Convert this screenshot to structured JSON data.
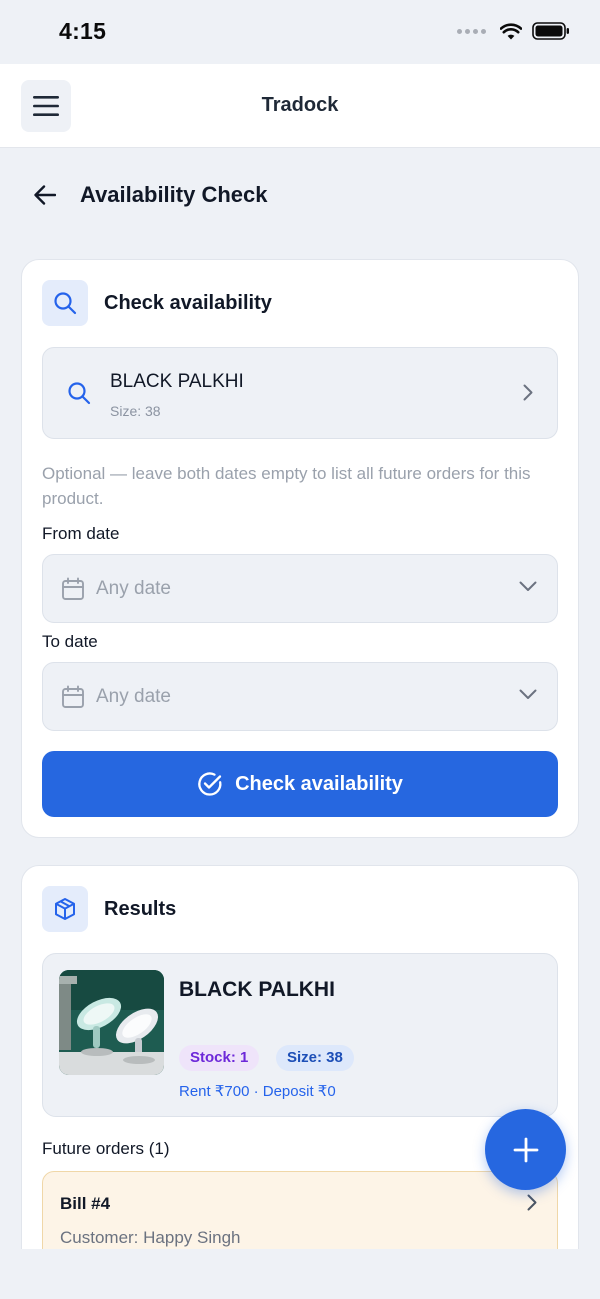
{
  "status_bar": {
    "time": "4:15"
  },
  "header": {
    "title": "Tradock"
  },
  "page": {
    "title": "Availability Check"
  },
  "search_card": {
    "title": "Check availability",
    "product": {
      "name": "BLACK PALKHI",
      "size": "Size: 38"
    },
    "hint": "Optional — leave both dates empty to list all future orders for this product.",
    "from_label": "From date",
    "from_value": "Any date",
    "to_label": "To date",
    "to_value": "Any date",
    "submit_label": "Check availability"
  },
  "results_card": {
    "title": "Results",
    "item": {
      "name": "BLACK PALKHI",
      "stock": "Stock: 1",
      "size": "Size: 38",
      "price": "Rent ₹700 · Deposit ₹0"
    },
    "future_label": "Future orders (1)",
    "orders": [
      {
        "bill": "Bill #4",
        "customer": "Customer: Happy Singh"
      }
    ]
  },
  "colors": {
    "accent": "#2667e0",
    "background": "#eef1f6",
    "order_bg": "#fdf4e7",
    "stock_chip": "#efe4fa",
    "size_chip": "#dde8fb"
  },
  "icons": {
    "menu": "menu-icon",
    "back": "arrow-left-icon",
    "search": "search-icon",
    "calendar": "calendar-icon",
    "chevron_down": "chevron-down-icon",
    "chevron_right": "chevron-right-icon",
    "check_circle": "check-circle-icon",
    "box": "package-icon",
    "add": "plus-icon"
  }
}
